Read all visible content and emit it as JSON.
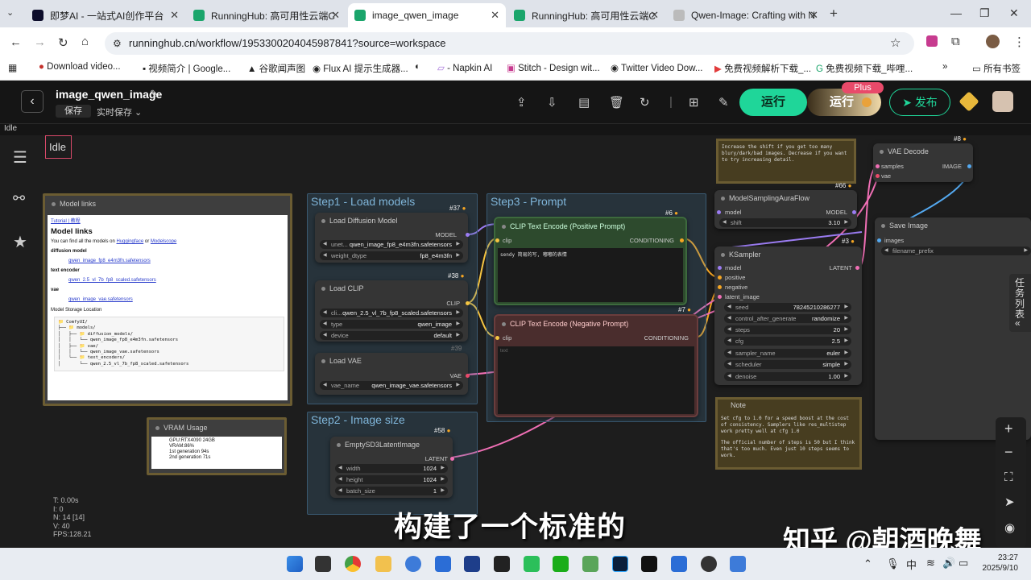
{
  "browser": {
    "tabs": [
      {
        "label": "即梦AI - 一站式AI创作平台",
        "color": "#0d0d2b"
      },
      {
        "label": "RunningHub: 高可用性云端C",
        "color": "#1aa56b"
      },
      {
        "label": "image_qwen_image",
        "color": "#1aa56b"
      },
      {
        "label": "RunningHub: 高可用性云端C",
        "color": "#1aa56b"
      },
      {
        "label": "Qwen-Image: Crafting with N",
        "color": "#555"
      }
    ],
    "url": "runninghub.cn/workflow/1953300204045987841?source=workspace",
    "bookmarks": [
      "Download video...",
      "视频简介 | Google...",
      "谷歌闻声图",
      "Flux AI 提示生成器...",
      "",
      "- Napkin AI",
      "Stitch - Design wit...",
      "Twitter Video Dow...",
      "免费视频解析下载_...",
      "免费视频下载_哔哩..."
    ],
    "bookmarks_folder": "所有书签"
  },
  "app": {
    "title": "image_qwen_image",
    "save": "保存",
    "autosave": "实时保存",
    "run": "运行",
    "run_plus": "运行",
    "plus_badge": "Plus",
    "publish": "发布",
    "status": "Idle",
    "queue_tab": "任务列表"
  },
  "canvas": {
    "idle_label": "Idle",
    "stats": [
      "T: 0.00s",
      "I: 0",
      "N: 14 [14]",
      "V: 40",
      "FPS:128.21"
    ],
    "groups": {
      "step1": "Step1 - Load models",
      "step2": "Step2 - Image size",
      "step3": "Step3 - Prompt"
    },
    "model_links": {
      "title": "Model links",
      "links": "Tutorial | 教程",
      "heading": "Model links",
      "intro_text": "You can find all the models on",
      "hf": "Huggingface",
      "or": "or",
      "ms": "Modelscope",
      "dm_label": "diffusion model",
      "dm_file": "qwen_image_fp8_e4m3fn.safetensors",
      "te_label": "text encoder",
      "te_file": "qwen_2.5_vl_7b_fp8_scaled.safetensors",
      "vae_label": "vae",
      "vae_file": "qwen_image_vae.safetensors",
      "storage": "Model Storage Location",
      "tree": [
        "📁 ComfyUI/",
        "├── 📁 models/",
        "│   ├── 📁 diffusion_models/",
        "│   │   └── qwen_image_fp8_e4m3fn.safetensors",
        "│   ├── 📁 vae/",
        "│   │   └── qwen_image_vae.safetensors",
        "│   └── 📁 text_encoders/",
        "│       └── qwen_2.5_vl_7b_fp8_scaled.safetensors"
      ]
    },
    "vram": {
      "title": "VRAM Usage",
      "items": [
        "GPU:RTX4090 24GB",
        "VRAM:86%",
        "1st generation 94s",
        "2nd generation 71s"
      ]
    },
    "load_diffusion": {
      "title": "Load Diffusion Model",
      "badge": "#37",
      "out": "MODEL",
      "w1k": "unet...",
      "w1v": "qwen_image_fp8_e4m3fn.safetensors",
      "w2k": "weight_dtype",
      "w2v": "fp8_e4m3fn"
    },
    "load_clip": {
      "title": "Load CLIP",
      "badge": "#38",
      "out": "CLIP",
      "w1k": "cli...",
      "w1v": "qwen_2.5_vl_7b_fp8_scaled.safetensors",
      "w2k": "type",
      "w2v": "qwen_image",
      "w3k": "device",
      "w3v": "default"
    },
    "load_vae": {
      "title": "Load VAE",
      "badge": "#39",
      "out": "VAE",
      "w1k": "vae_name",
      "w1v": "qwen_image_vae.safetensors"
    },
    "latent": {
      "title": "EmptySD3LatentImage",
      "badge": "#58",
      "out": "LATENT",
      "w1k": "width",
      "w1v": "1024",
      "w2k": "height",
      "w2v": "1024",
      "w3k": "batch_size",
      "w3v": "1"
    },
    "pos": {
      "title": "CLIP Text Encode (Positive Prompt)",
      "badge": "#6",
      "in": "clip",
      "out": "CONDITIONING",
      "text": "sendy 简易的写, 嘟嘟的表情"
    },
    "neg": {
      "title": "CLIP Text Encode (Negative Prompt)",
      "badge": "#7",
      "in": "clip",
      "out": "CONDITIONING",
      "text": "text"
    },
    "note_top": "Increase the shift if you get too many blury/dark/bad images. Decrease if you want to try increasing detail.",
    "aura": {
      "title": "ModelSamplingAuraFlow",
      "badge": "#66",
      "in": "model",
      "out": "MODEL",
      "w1k": "shift",
      "w1v": "3.10"
    },
    "ksampler": {
      "title": "KSampler",
      "badge": "#3",
      "ins": [
        "model",
        "positive",
        "negative",
        "latent_image"
      ],
      "out": "LATENT",
      "widgets": [
        [
          "seed",
          "78245210286277"
        ],
        [
          "control_after_generate",
          "randomize"
        ],
        [
          "steps",
          "20"
        ],
        [
          "cfg",
          "2.5"
        ],
        [
          "sampler_name",
          "euler"
        ],
        [
          "scheduler",
          "simple"
        ],
        [
          "denoise",
          "1.00"
        ]
      ]
    },
    "note": {
      "title": "Note",
      "text1": "Set cfg to 1.0 for a speed boost at the cost of consistency. Samplers like res_multistep work pretty well at cfg 1.0",
      "text2": "The official number of steps is 50 but I think that's too much. Even just 10 steps seems to work."
    },
    "vae_decode": {
      "title": "VAE Decode",
      "badge": "#8",
      "ins": [
        "samples",
        "vae"
      ],
      "out": "IMAGE"
    },
    "save": {
      "title": "Save Image",
      "in": "images",
      "w1k": "filename_prefix"
    }
  },
  "overlay": {
    "subtitle": "构建了一个标准的",
    "watermark": "知乎 @朝酒晚舞"
  },
  "taskbar": {
    "ime": "中",
    "time": "23:27",
    "date": "2025/9/10"
  }
}
